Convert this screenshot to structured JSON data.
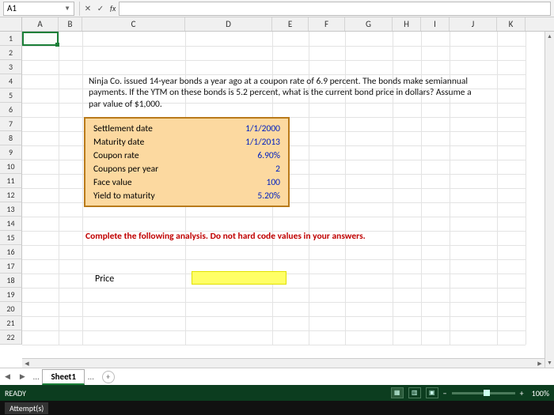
{
  "namebox": {
    "ref": "A1"
  },
  "formula_bar": {
    "value": ""
  },
  "columns": [
    "A",
    "B",
    "C",
    "D",
    "E",
    "F",
    "G",
    "H",
    "I",
    "J",
    "K"
  ],
  "rows": [
    "1",
    "2",
    "3",
    "4",
    "5",
    "6",
    "7",
    "8",
    "9",
    "10",
    "11",
    "12",
    "13",
    "14",
    "15",
    "16",
    "17",
    "18",
    "19",
    "20",
    "21",
    "22"
  ],
  "problem_text": "Ninja Co. issued 14-year bonds a year ago at a coupon rate of 6.9 percent. The bonds make semiannual payments. If the YTM on these bonds is 5.2 percent, what is the current bond price in dollars? Assume a par value of $1,000.",
  "inputs": {
    "settlement": {
      "label": "Settlement date",
      "value": "1/1/2000"
    },
    "maturity": {
      "label": "Maturity date",
      "value": "1/1/2013"
    },
    "coupon": {
      "label": "Coupon rate",
      "value": "6.90%"
    },
    "periods": {
      "label": "Coupons per year",
      "value": "2"
    },
    "face": {
      "label": "Face value",
      "value": "100"
    },
    "ytm": {
      "label": "Yield to maturity",
      "value": "5.20%"
    }
  },
  "instruction": "Complete the following analysis. Do not hard code values in your answers.",
  "answer": {
    "label": "Price",
    "value": ""
  },
  "tabs": {
    "nav_prev": "◀",
    "nav_next": "▶",
    "dots": "…",
    "active": "Sheet1",
    "add": "+"
  },
  "status": {
    "left": "READY",
    "views": [
      "▦",
      "▥",
      "▣"
    ],
    "minus": "−",
    "plus": "+",
    "zoom": "100%"
  },
  "status2": {
    "label": "Attempt(s)"
  }
}
